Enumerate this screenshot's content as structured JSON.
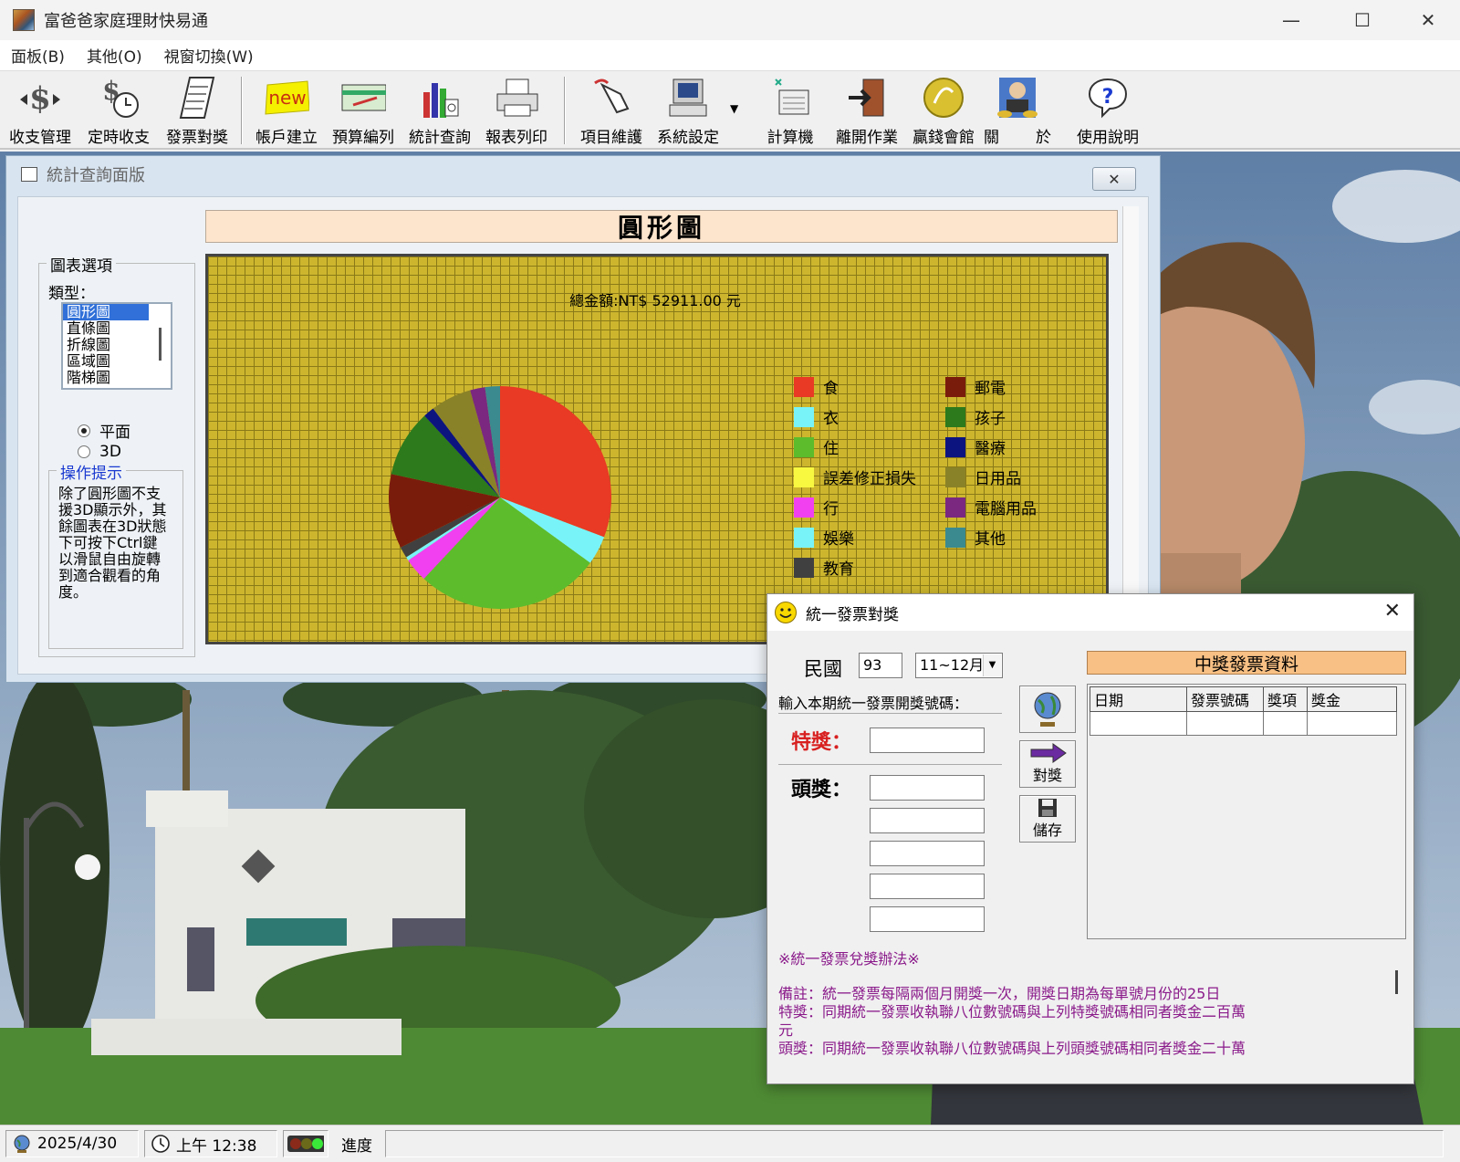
{
  "window": {
    "title": "富爸爸家庭理財快易通"
  },
  "menubar": {
    "items": [
      "面板(B)",
      "其他(O)",
      "視窗切換(W)"
    ]
  },
  "toolbar": {
    "buttons": [
      "收支管理",
      "定時收支",
      "發票對獎",
      "帳戶建立",
      "預算編列",
      "統計查詢",
      "報表列印",
      "項目維護",
      "系統設定",
      "計算機",
      "離開作業",
      "贏錢會館",
      "關",
      "於",
      "使用說明"
    ],
    "new_badge": "new"
  },
  "stats_panel": {
    "title": "統計查詢面版",
    "heading": "圓形圖",
    "options_legend": "圖表選項",
    "type_label": "類型：",
    "chart_types": [
      "圓形圖",
      "直條圖",
      "折線圖",
      "區域圖",
      "階梯圖"
    ],
    "selected_type": "圓形圖",
    "view_modes": [
      "平面",
      "3D"
    ],
    "selected_mode": "平面",
    "hint_legend": "操作提示",
    "hint_text": "除了圓形圖不支援3D顯示外，其餘圖表在3D狀態下可按下Ctrl鍵以滑鼠自由旋轉到適合觀看的角度。"
  },
  "chart_data": {
    "type": "pie",
    "title": "總金額:NT$ 52911.00 元",
    "total": 52911.0,
    "slices": [
      {
        "label": "食",
        "value": 15080,
        "color": "#e83a24"
      },
      {
        "label": "衣",
        "value": 2060,
        "color": "#78f4f8"
      },
      {
        "label": "住",
        "value": 13230,
        "color": "#5cbc2c"
      },
      {
        "label": "誤差修正損失",
        "value": 0,
        "color": "#f8f840"
      },
      {
        "label": "行",
        "value": 1690,
        "color": "#f040f0"
      },
      {
        "label": "娛樂",
        "value": 260,
        "color": "#78f4f8"
      },
      {
        "label": "教育",
        "value": 790,
        "color": "#404040"
      },
      {
        "label": "郵電",
        "value": 5290,
        "color": "#7a1c0c"
      },
      {
        "label": "孩子",
        "value": 4770,
        "color": "#2c7a1c"
      },
      {
        "label": "醫療",
        "value": 790,
        "color": "#0c1480"
      },
      {
        "label": "日用品",
        "value": 2910,
        "color": "#8a8228"
      },
      {
        "label": "電腦用品",
        "value": 1060,
        "color": "#7a2880"
      },
      {
        "label": "其他",
        "value": 1060,
        "color": "#3a8a90"
      }
    ],
    "legend_position": "right"
  },
  "invoice_dialog": {
    "title": "統一發票對獎",
    "year_label": "民國",
    "year_value": "93",
    "period_value": "11~12月",
    "input_prompt": "輸入本期統一發票開獎號碼：",
    "special_prize_label": "特獎：",
    "first_prize_label": "頭獎：",
    "check_button": "對獎",
    "save_button": "儲存",
    "winning_header": "中獎發票資料",
    "table_columns": [
      "日期",
      "發票號碼",
      "獎項",
      "獎金"
    ],
    "rules_title": "※統一發票兌獎辦法※",
    "rules_lines": [
      "備註：統一發票每隔兩個月開獎一次，開獎日期為每單號月份的25日",
      "特獎：同期統一發票收執聯八位數號碼與上列特獎號碼相同者獎金二百萬",
      "元",
      "頭獎：同期統一發票收執聯八位數號碼與上列頭獎號碼相同者獎金二十萬"
    ]
  },
  "statusbar": {
    "date": "2025/4/30",
    "time": "上午 12:38",
    "progress_label": "進度"
  }
}
